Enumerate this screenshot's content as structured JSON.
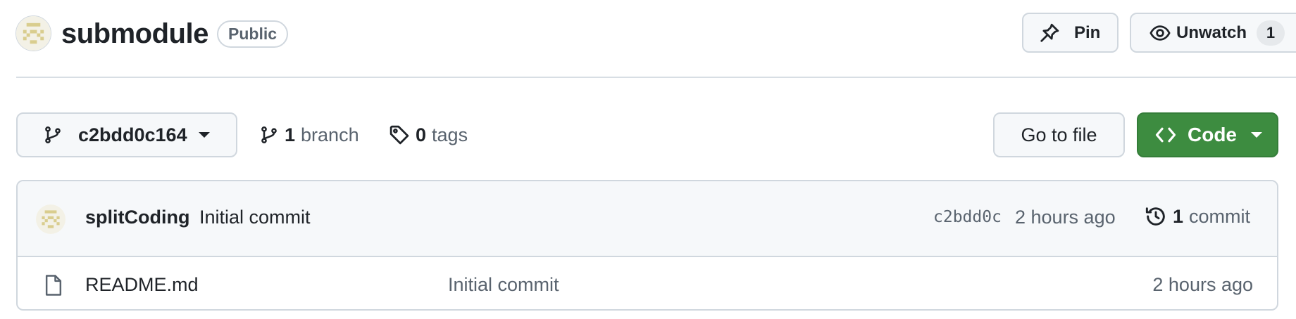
{
  "repo": {
    "name": "submodule",
    "visibility": "Public"
  },
  "actions": {
    "pin_label": "Pin",
    "watch_label": "Unwatch",
    "watch_count": "1"
  },
  "toolbar": {
    "branch_name": "c2bdd0c164",
    "branch_count": "1",
    "branch_label": "branch",
    "tag_count": "0",
    "tag_label": "tags",
    "go_to_file_label": "Go to file",
    "code_label": "Code"
  },
  "latest_commit": {
    "author": "splitCoding",
    "message": "Initial commit",
    "hash": "c2bdd0c",
    "time": "2 hours ago",
    "count": "1",
    "count_label": "commit"
  },
  "files": [
    {
      "name": "README.md",
      "message": "Initial commit",
      "time": "2 hours ago",
      "icon": "file-icon"
    }
  ],
  "icons": {
    "pin": "pin-icon",
    "watch": "eye-icon",
    "branch": "git-branch-icon",
    "tag": "tag-icon",
    "code": "code-icon",
    "history": "history-icon",
    "avatar": "identicon-avatar"
  },
  "colors": {
    "code_button": "#3d8c40",
    "identicon": "#d9cd8e",
    "border": "#d0d7de",
    "muted_text": "#59636e"
  }
}
